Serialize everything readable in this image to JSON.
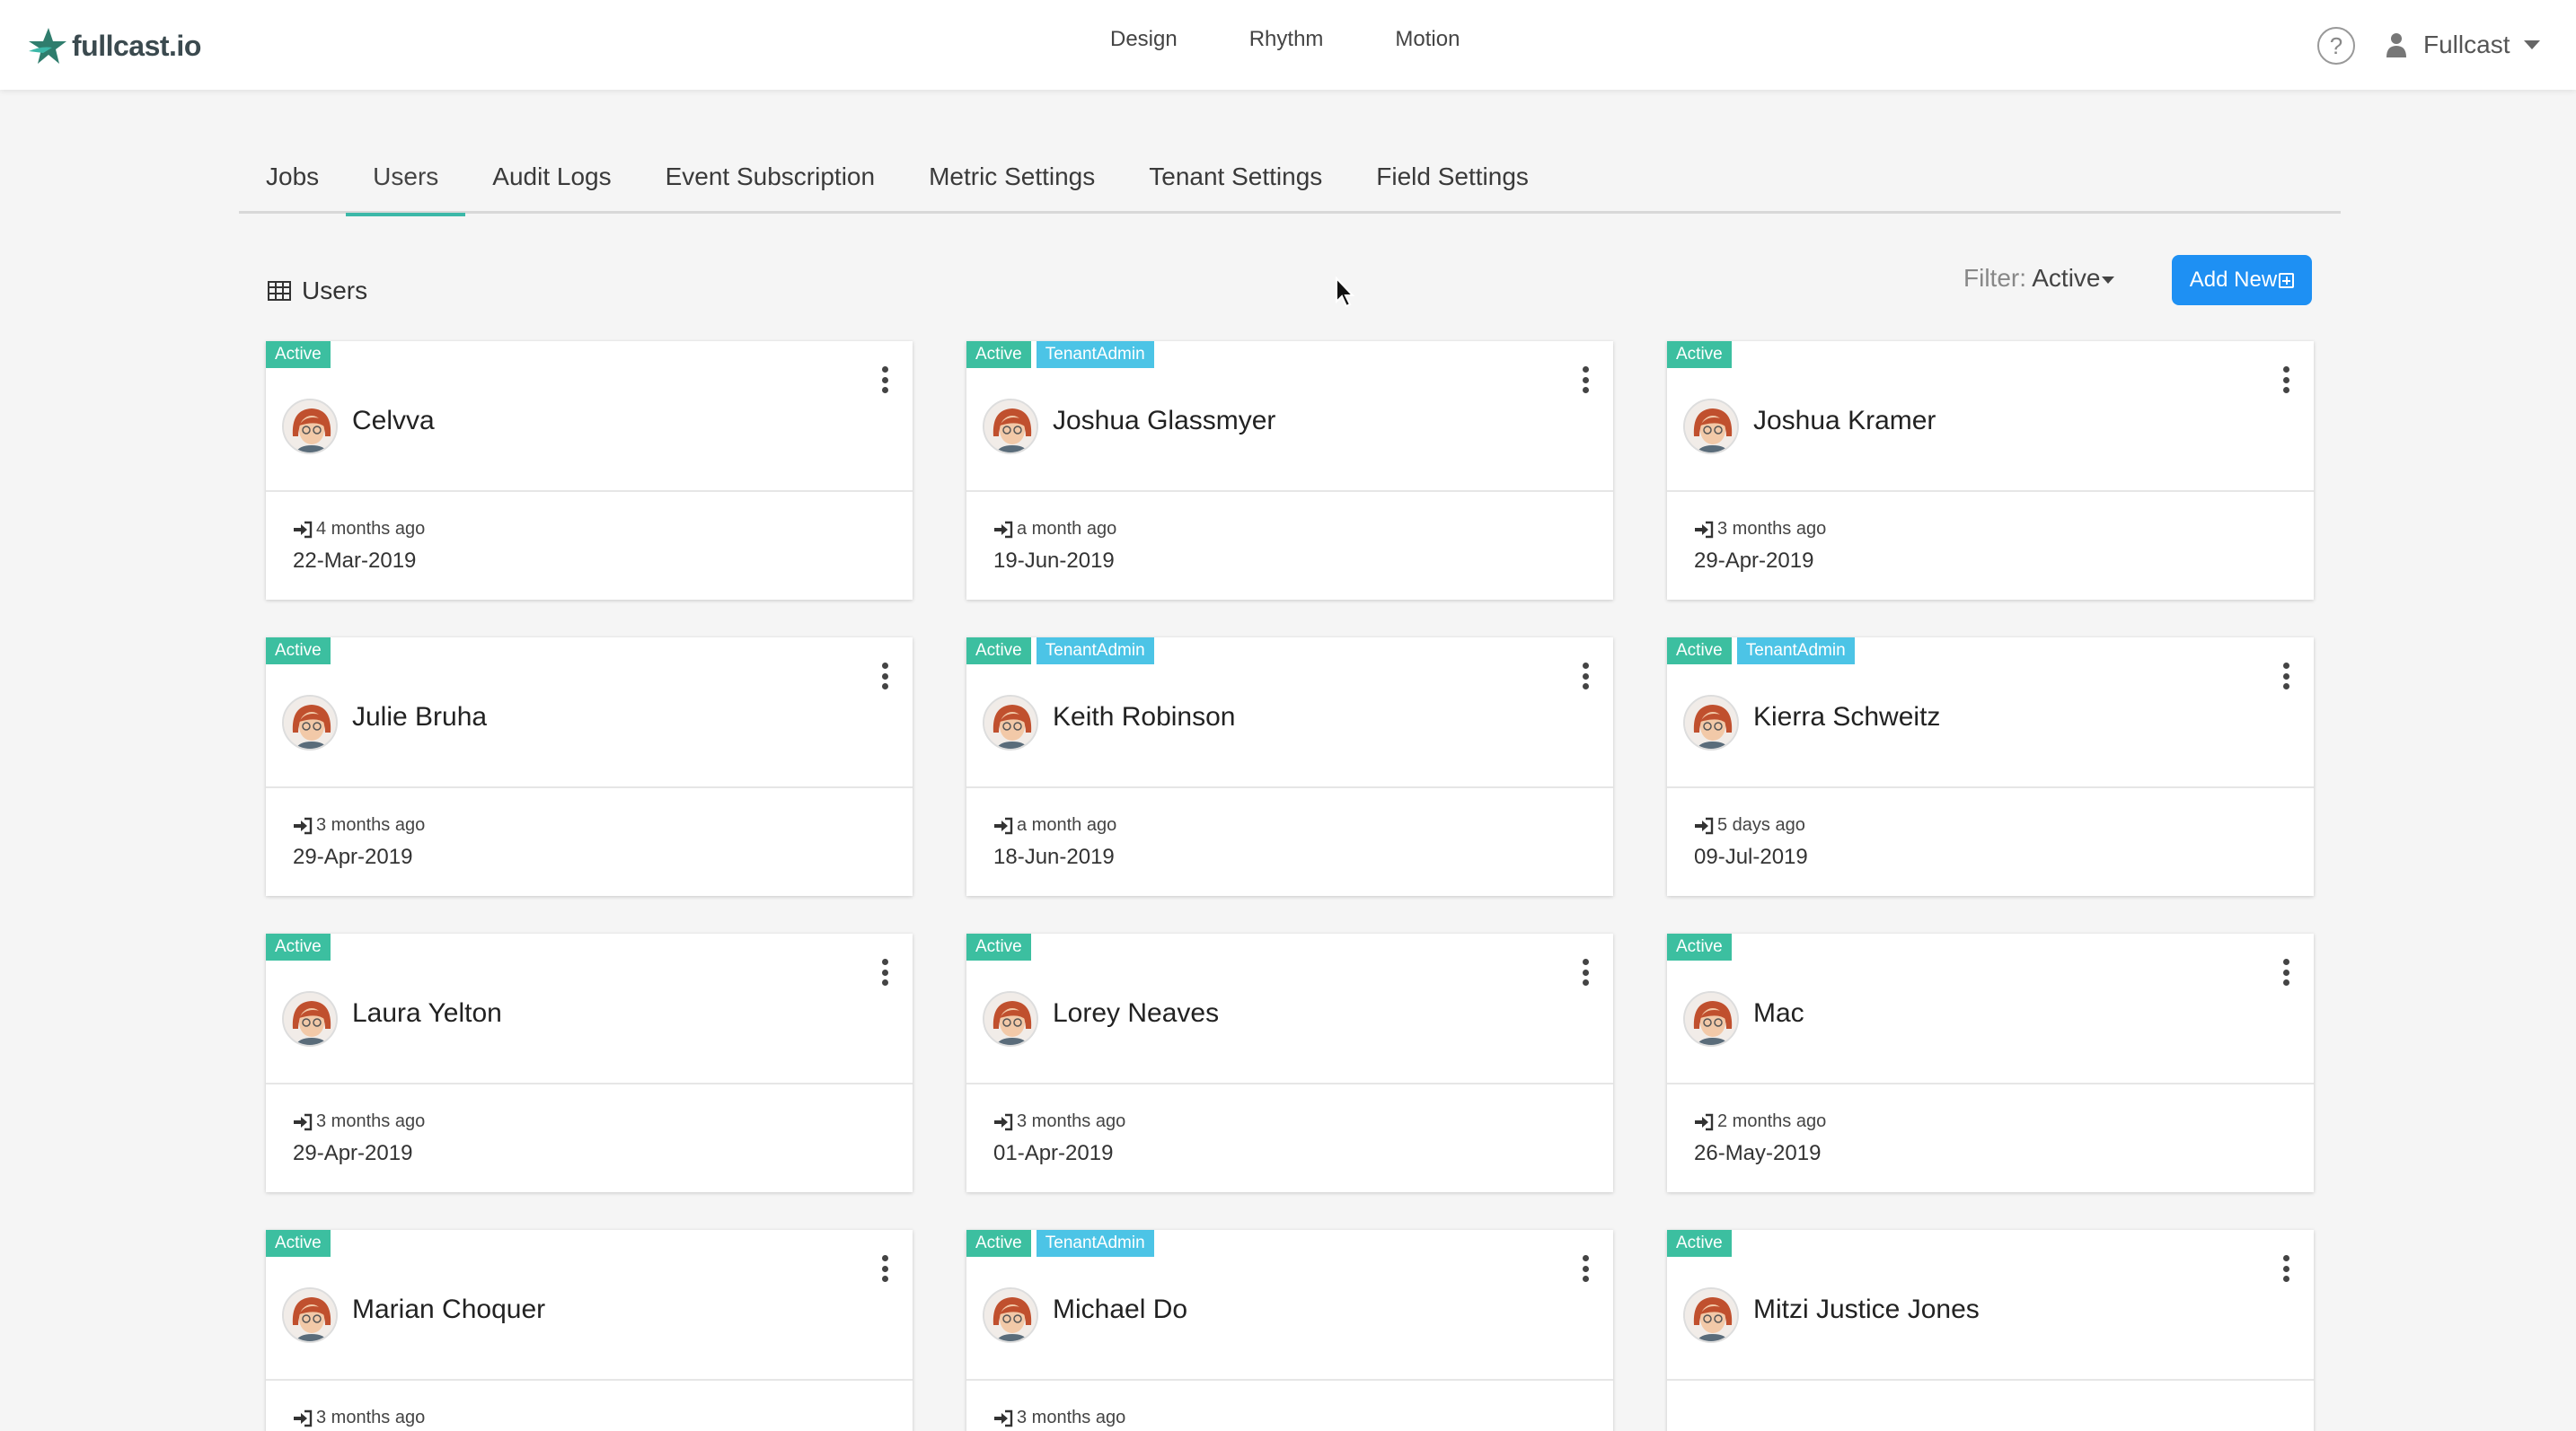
{
  "brand": {
    "name": "fullcast.io"
  },
  "topnav": {
    "items": [
      "Design",
      "Rhythm",
      "Motion"
    ]
  },
  "header": {
    "help_symbol": "?",
    "user_name": "Fullcast"
  },
  "tabs": [
    {
      "label": "Jobs",
      "active": false
    },
    {
      "label": "Users",
      "active": true
    },
    {
      "label": "Audit Logs",
      "active": false
    },
    {
      "label": "Event Subscription",
      "active": false
    },
    {
      "label": "Metric Settings",
      "active": false
    },
    {
      "label": "Tenant Settings",
      "active": false
    },
    {
      "label": "Field Settings",
      "active": false
    }
  ],
  "section": {
    "title": "Users",
    "filter_label": "Filter:",
    "filter_value": "Active",
    "add_button": "Add New"
  },
  "colors": {
    "accent": "#3cb8a8",
    "active_badge": "#3cbfa0",
    "admin_badge": "#4cc4e6",
    "primary_button": "#1e90f3"
  },
  "users": [
    {
      "name": "Celvva",
      "badges": [
        "Active"
      ],
      "last_login": "4 months ago",
      "date": "22-Mar-2019"
    },
    {
      "name": "Joshua Glassmyer",
      "badges": [
        "Active",
        "TenantAdmin"
      ],
      "last_login": "a month ago",
      "date": "19-Jun-2019"
    },
    {
      "name": "Joshua Kramer",
      "badges": [
        "Active"
      ],
      "last_login": "3 months ago",
      "date": "29-Apr-2019"
    },
    {
      "name": "Julie Bruha",
      "badges": [
        "Active"
      ],
      "last_login": "3 months ago",
      "date": "29-Apr-2019"
    },
    {
      "name": "Keith Robinson",
      "badges": [
        "Active",
        "TenantAdmin"
      ],
      "last_login": "a month ago",
      "date": "18-Jun-2019"
    },
    {
      "name": "Kierra Schweitz",
      "badges": [
        "Active",
        "TenantAdmin"
      ],
      "last_login": "5 days ago",
      "date": "09-Jul-2019"
    },
    {
      "name": "Laura Yelton",
      "badges": [
        "Active"
      ],
      "last_login": "3 months ago",
      "date": "29-Apr-2019"
    },
    {
      "name": "Lorey Neaves",
      "badges": [
        "Active"
      ],
      "last_login": "3 months ago",
      "date": "01-Apr-2019"
    },
    {
      "name": "Mac",
      "badges": [
        "Active"
      ],
      "last_login": "2 months ago",
      "date": "26-May-2019"
    },
    {
      "name": "Marian Choquer",
      "badges": [
        "Active"
      ],
      "last_login": "3 months ago",
      "date": ""
    },
    {
      "name": "Michael Do",
      "badges": [
        "Active",
        "TenantAdmin"
      ],
      "last_login": "3 months ago",
      "date": ""
    },
    {
      "name": "Mitzi Justice Jones",
      "badges": [
        "Active"
      ],
      "last_login": "",
      "date": ""
    }
  ]
}
